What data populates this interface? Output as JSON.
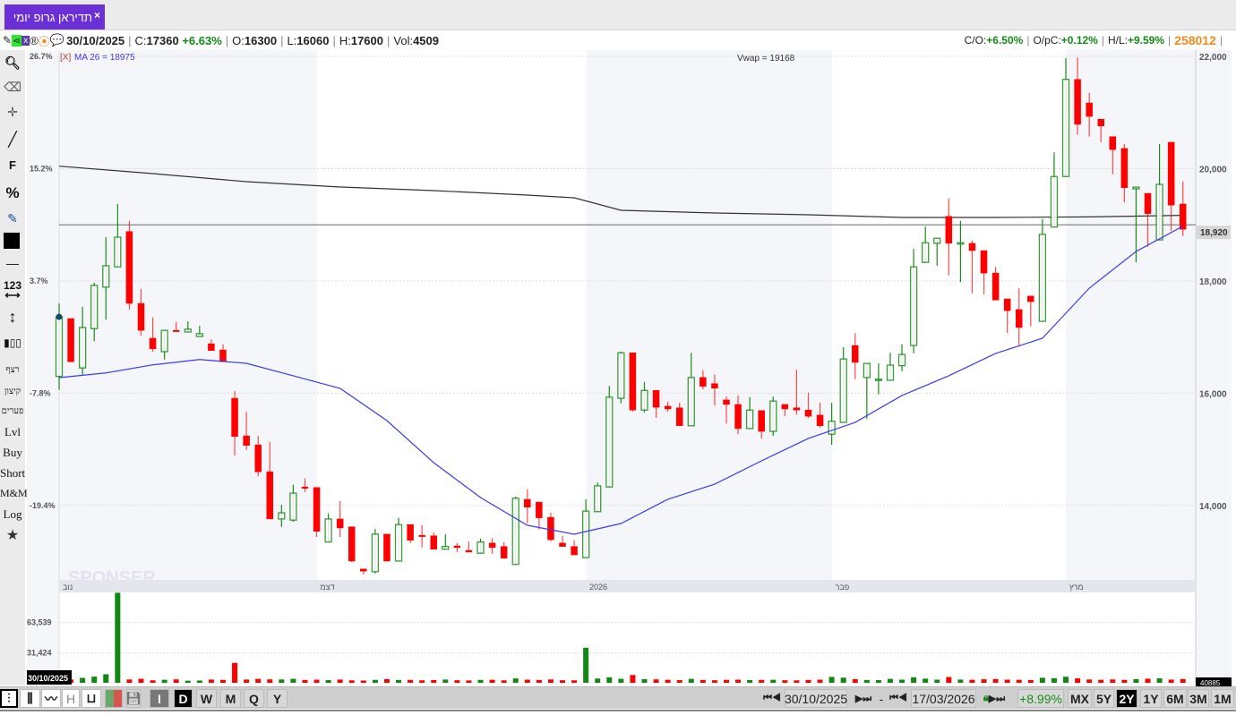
{
  "tab": {
    "title": "תדיראן גרופ יומי",
    "close": "×"
  },
  "info": {
    "date": "30/10/2025",
    "close_label": "C:",
    "close": "17360",
    "change": "+6.63%",
    "open_label": "O:",
    "open": "16300",
    "low_label": "L:",
    "low": "16060",
    "high_label": "H:",
    "high": "17600",
    "vol_label": "Vol:",
    "vol": "4509",
    "co_label": "C/O:",
    "co": "+6.50%",
    "opc_label": "O/pC:",
    "opc": "+0.12%",
    "hl_label": "H/L:",
    "hl": "+9.59%",
    "id_number": "258012"
  },
  "indicators": {
    "ma_remove": "[X]",
    "ma_label": "MA 26 = 18975",
    "vwap_label": "Vwap  =  19168"
  },
  "left_toolbar": [
    "search-icon",
    "eraser-icon",
    "crosshair-icon",
    "line-icon",
    "F",
    "%",
    "edit-icon",
    "color-icon",
    "hline-icon",
    "123",
    "vertical-arrow-icon",
    "candles-icon",
    "רצף",
    "קיצון",
    "פערים",
    "Lvl",
    "Buy",
    "Short",
    "M&M",
    "Log",
    "star-icon"
  ],
  "left_toolbar_text": {
    "f": "F",
    "pct": "%",
    "num": "123",
    "rezef": "רצף",
    "kitzon": "קיצון",
    "paarim": "פערים",
    "lvl": "Lvl",
    "buy": "Buy",
    "short": "Short",
    "mm": "M&M",
    "log": "Log"
  },
  "bottom": {
    "styles": [
      "candles",
      "bars",
      "line",
      "H",
      "U",
      "colors"
    ],
    "save": "save-icon",
    "intervals": [
      "I",
      "D",
      "W",
      "M",
      "Q",
      "Y"
    ],
    "selected_interval": "D",
    "from_date": "30/10/2025",
    "to_date": "17/03/2026",
    "dash": "-",
    "range_change": "+8.99%",
    "ranges": [
      "MX",
      "5Y",
      "2Y",
      "1Y",
      "6M",
      "3M",
      "1M"
    ],
    "selected_range": "2Y"
  },
  "colors": {
    "up": "#1a8c1a",
    "down": "#ff0000",
    "ma": "#3b3bf0",
    "vwap": "#333333",
    "last_line": "#c86a1e",
    "tab": "#6b2fd6"
  },
  "chart_data": {
    "type": "candlestick",
    "price_ticks": [
      "22,000",
      "20,000",
      "18,000",
      "16,000",
      "14,000"
    ],
    "price_tick_values": [
      22000,
      20000,
      18000,
      16000,
      14000
    ],
    "pct_ticks": [
      "26.7%",
      "15.2%",
      "3.7%",
      "-7.8%",
      "-19.4%"
    ],
    "last_price_label": "18,920",
    "last_price": 18920,
    "x_labels": [
      {
        "label": "נוב",
        "candle": 0
      },
      {
        "label": "דצמ",
        "candle": 22
      },
      {
        "label": "2026",
        "candle": 45
      },
      {
        "label": "פבר",
        "candle": 66
      },
      {
        "label": "מרץ",
        "candle": 86
      }
    ],
    "volume_ticks": [
      "63,539",
      "31,424"
    ],
    "volume_tick_values": [
      63539,
      31424
    ],
    "volume_first_date": "30/10/2025",
    "volume_last_label": "40885",
    "ohlc": [
      [
        16300,
        17600,
        16060,
        17360
      ],
      [
        17330,
        17330,
        16560,
        16560
      ],
      [
        16450,
        17540,
        16330,
        17170
      ],
      [
        17150,
        17970,
        16930,
        17920
      ],
      [
        17890,
        18780,
        17310,
        18270
      ],
      [
        18250,
        19370,
        18250,
        18780
      ],
      [
        18880,
        19070,
        17490,
        17600
      ],
      [
        17600,
        17860,
        17030,
        17120
      ],
      [
        16980,
        17350,
        16740,
        16790
      ],
      [
        16740,
        17120,
        16600,
        17120
      ],
      [
        17120,
        17270,
        17110,
        17110
      ],
      [
        17090,
        17280,
        17090,
        17140
      ],
      [
        17010,
        17200,
        17010,
        17060
      ],
      [
        16880,
        16960,
        16760,
        16760
      ],
      [
        16770,
        16870,
        16560,
        16560
      ],
      [
        15910,
        16040,
        14890,
        15230
      ],
      [
        15240,
        15670,
        14990,
        15070
      ],
      [
        15080,
        15240,
        14520,
        14600
      ],
      [
        14600,
        15130,
        13760,
        13760
      ],
      [
        13760,
        14010,
        13620,
        13870
      ],
      [
        13740,
        14370,
        13710,
        14220
      ],
      [
        14330,
        14480,
        14240,
        14320
      ],
      [
        14320,
        14320,
        13440,
        13540
      ],
      [
        13350,
        13860,
        13350,
        13760
      ],
      [
        13760,
        14080,
        13440,
        13600
      ],
      [
        13620,
        13620,
        12990,
        13010
      ],
      [
        12870,
        12870,
        12770,
        12830
      ],
      [
        12820,
        13580,
        12790,
        13490
      ],
      [
        13490,
        13490,
        13010,
        13010
      ],
      [
        13010,
        13780,
        13010,
        13660
      ],
      [
        13660,
        13660,
        13330,
        13380
      ],
      [
        13470,
        13650,
        13250,
        13460
      ],
      [
        13460,
        13520,
        13220,
        13220
      ],
      [
        13220,
        13490,
        13220,
        13270
      ],
      [
        13280,
        13330,
        13170,
        13250
      ],
      [
        13200,
        13360,
        13170,
        13170
      ],
      [
        13150,
        13410,
        13150,
        13350
      ],
      [
        13330,
        13420,
        13140,
        13250
      ],
      [
        13270,
        13350,
        13060,
        13060
      ],
      [
        12950,
        14160,
        12950,
        14130
      ],
      [
        14110,
        14290,
        13680,
        13970
      ],
      [
        14060,
        14060,
        13570,
        13780
      ],
      [
        13790,
        13870,
        13360,
        13390
      ],
      [
        13330,
        13460,
        13270,
        13270
      ],
      [
        13270,
        13380,
        13120,
        13120
      ],
      [
        13070,
        14110,
        13070,
        13900
      ],
      [
        13890,
        14410,
        13890,
        14350
      ],
      [
        14330,
        16130,
        14330,
        15930
      ],
      [
        15910,
        16740,
        15820,
        16720
      ],
      [
        16720,
        16720,
        15670,
        15700
      ],
      [
        15700,
        16200,
        15660,
        16050
      ],
      [
        16050,
        16050,
        15560,
        15750
      ],
      [
        15770,
        15850,
        15670,
        15720
      ],
      [
        15740,
        15830,
        15420,
        15420
      ],
      [
        15420,
        16720,
        15420,
        16280
      ],
      [
        16280,
        16410,
        16070,
        16120
      ],
      [
        16170,
        16330,
        15780,
        16090
      ],
      [
        15880,
        15940,
        15460,
        15800
      ],
      [
        15800,
        15960,
        15270,
        15370
      ],
      [
        15370,
        15930,
        15370,
        15700
      ],
      [
        15690,
        15690,
        15190,
        15320
      ],
      [
        15320,
        15940,
        15240,
        15860
      ],
      [
        15800,
        15800,
        15590,
        15720
      ],
      [
        15740,
        16420,
        15620,
        15700
      ],
      [
        15700,
        16010,
        15560,
        15590
      ],
      [
        15610,
        15830,
        15390,
        15420
      ],
      [
        15270,
        15830,
        15080,
        15500
      ],
      [
        15480,
        16820,
        15480,
        16610
      ],
      [
        16850,
        17070,
        16250,
        16550
      ],
      [
        16280,
        16530,
        15540,
        16530
      ],
      [
        16230,
        16530,
        15980,
        16250
      ],
      [
        16230,
        16720,
        16230,
        16500
      ],
      [
        16490,
        16870,
        16390,
        16690
      ],
      [
        16850,
        18570,
        16710,
        18250
      ],
      [
        18330,
        18970,
        18330,
        18680
      ],
      [
        18670,
        18760,
        18270,
        18760
      ],
      [
        19150,
        19470,
        18100,
        18670
      ],
      [
        18670,
        19070,
        17980,
        18680
      ],
      [
        18670,
        18720,
        17780,
        18540
      ],
      [
        18540,
        18540,
        17760,
        18140
      ],
      [
        18140,
        18250,
        17660,
        17660
      ],
      [
        17680,
        17680,
        17070,
        17470
      ],
      [
        17490,
        17870,
        16850,
        17170
      ],
      [
        17730,
        17730,
        17190,
        17630
      ],
      [
        17280,
        19100,
        17280,
        18830
      ],
      [
        18960,
        20290,
        18960,
        19860
      ],
      [
        19860,
        21970,
        19860,
        21590
      ],
      [
        21590,
        21980,
        20600,
        20790
      ],
      [
        21170,
        21350,
        20570,
        20930
      ],
      [
        20880,
        20880,
        20470,
        20760
      ],
      [
        20570,
        20570,
        19900,
        20340
      ],
      [
        20360,
        20440,
        19400,
        19660
      ],
      [
        19640,
        19670,
        18330,
        19670
      ],
      [
        19560,
        19560,
        18610,
        19200
      ],
      [
        18730,
        20440,
        18730,
        19720
      ],
      [
        20470,
        20470,
        18890,
        19350
      ],
      [
        19370,
        19770,
        18800,
        18920
      ]
    ],
    "volume": [
      4509,
      3500,
      5200,
      6500,
      9000,
      95000,
      3500,
      4200,
      2600,
      3200,
      3600,
      2200,
      2400,
      3400,
      3100,
      21000,
      3400,
      4100,
      3600,
      3500,
      4200,
      3000,
      3300,
      2800,
      3400,
      2600,
      2400,
      3100,
      3800,
      3000,
      3100,
      2600,
      2900,
      3400,
      2700,
      2500,
      3100,
      3200,
      2600,
      4600,
      3300,
      3000,
      3500,
      2700,
      2600,
      37000,
      4500,
      5800,
      4200,
      8200,
      3800,
      3600,
      3200,
      2800,
      4100,
      3000,
      2700,
      3100,
      3300,
      2900,
      3100,
      3200,
      2700,
      2600,
      3000,
      3300,
      6200,
      5400,
      3800,
      3000,
      2800,
      4100,
      3300,
      5800,
      4400,
      3300,
      6100,
      3400,
      3200,
      3700,
      3900,
      3300,
      3200,
      2900,
      5300,
      4800,
      6400,
      4700,
      3500,
      3200,
      3500,
      3100,
      3800,
      4300,
      4700,
      3400,
      3900
    ],
    "ma26_samples": {
      "every_n_candles": 4,
      "values": [
        16277,
        16361,
        16505,
        16600,
        16532,
        16310,
        16086,
        15512,
        14763,
        14142,
        13647,
        13488,
        13679,
        14110,
        14380,
        14795,
        15194,
        15480,
        15959,
        16310,
        16708,
        16979,
        17871,
        18525,
        18975
      ]
    },
    "vwap_samples": {
      "candles": [
        0,
        8,
        16,
        24,
        32,
        40,
        44,
        48,
        56,
        64,
        72,
        80,
        88,
        96
      ],
      "values": [
        20044,
        19912,
        19768,
        19673,
        19609,
        19529,
        19481,
        19258,
        19210,
        19178,
        19131,
        19131,
        19140,
        19168
      ]
    }
  }
}
